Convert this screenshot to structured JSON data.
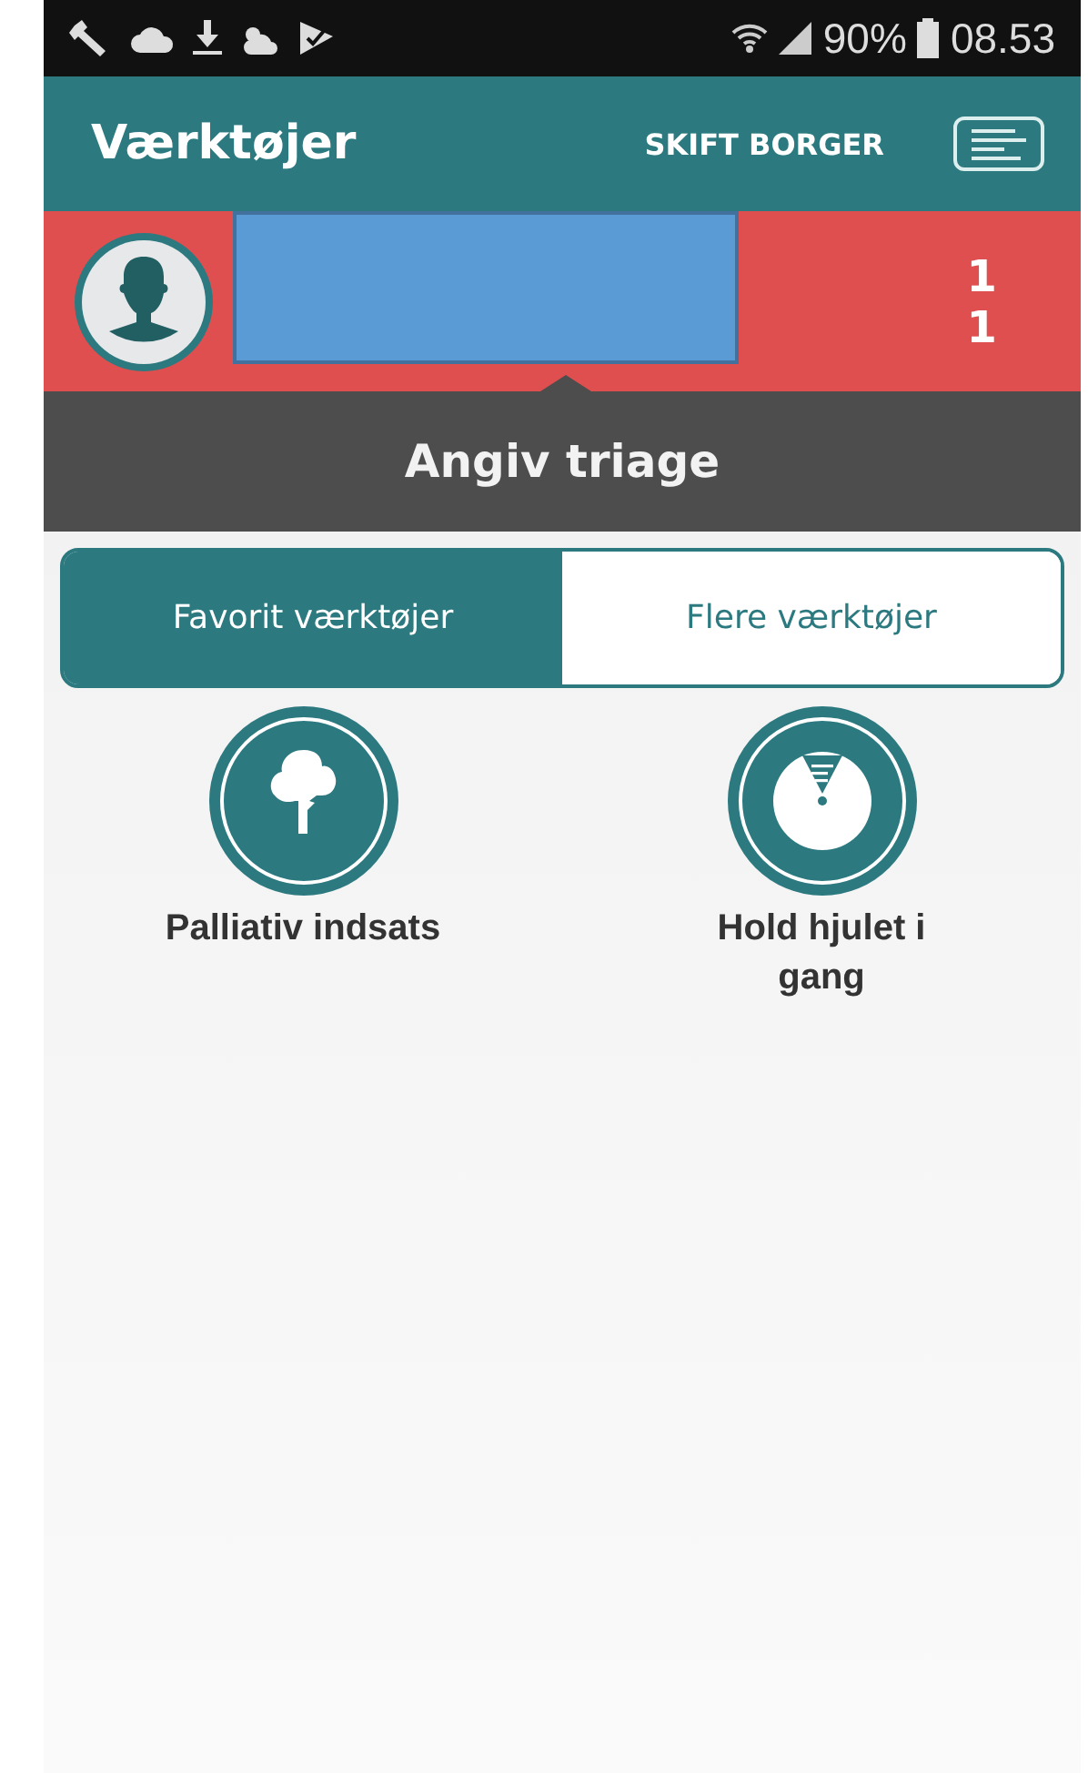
{
  "status_bar": {
    "battery": "90%",
    "time": "08.53"
  },
  "app_bar": {
    "title": "Værktøjer",
    "action": "SKIFT BORGER"
  },
  "patient": {
    "counts": [
      "1",
      "1"
    ]
  },
  "banner": {
    "title": "Angiv triage"
  },
  "tabs": [
    {
      "label": "Favorit værktøjer",
      "selected": true
    },
    {
      "label": "Flere værktøjer",
      "selected": false
    }
  ],
  "tools": [
    {
      "label": "Palliativ indsats"
    },
    {
      "label": "Hold hjulet i gang"
    }
  ]
}
